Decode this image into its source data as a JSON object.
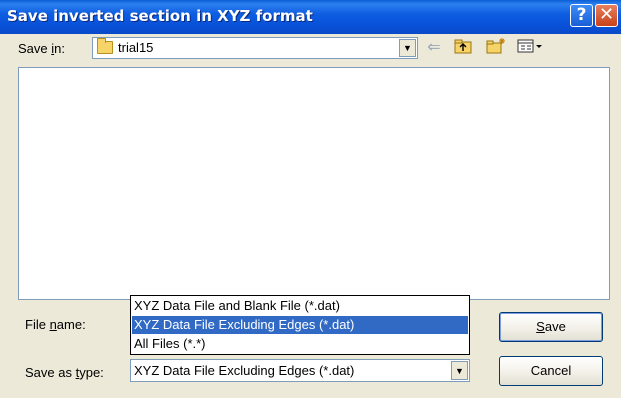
{
  "window": {
    "title": "Save inverted section in XYZ format",
    "help_glyph": "?",
    "close_glyph": "✕"
  },
  "save_in": {
    "label_prefix": "Save ",
    "label_accel": "i",
    "label_suffix": "n:",
    "value": "trial15",
    "icon": "folder-icon"
  },
  "toolbar": {
    "back_icon": "back-arrow-icon",
    "up_icon": "up-folder-icon",
    "new_folder_icon": "new-folder-icon",
    "views_icon": "views-menu-icon"
  },
  "file_name": {
    "label_prefix": "File ",
    "label_accel": "n",
    "label_suffix": "ame:"
  },
  "save_as_type": {
    "label_prefix": "Save as ",
    "label_accel": "t",
    "label_suffix": "ype:",
    "value": "XYZ Data File Excluding Edges (*.dat)",
    "options": [
      "XYZ Data File and Blank File (*.dat)",
      "XYZ Data File Excluding Edges (*.dat)",
      "All Files (*.*)"
    ],
    "selected_index": 1
  },
  "buttons": {
    "save_accel": "S",
    "save_rest": "ave",
    "cancel": "Cancel"
  },
  "colors": {
    "titlebar": "#0a5fd6",
    "selection": "#316ac5",
    "dialog_bg": "#ece9d8"
  }
}
